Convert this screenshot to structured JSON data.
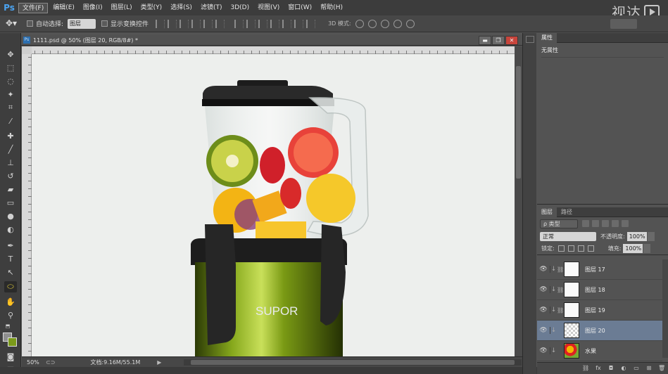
{
  "app": {
    "logo": "Ps",
    "watermark": "视达",
    "menu": [
      "文件(F)",
      "编辑(E)",
      "图像(I)",
      "图层(L)",
      "类型(Y)",
      "选择(S)",
      "滤镜(T)",
      "3D(D)",
      "视图(V)",
      "窗口(W)",
      "帮助(H)"
    ]
  },
  "options_bar": {
    "auto_select_label": "自动选择:",
    "auto_select_value": "图层",
    "show_transform_label": "显示变换控件",
    "mode_3d_label": "3D 模式:"
  },
  "document": {
    "title": "1111.psd @ 50% (图层 20, RGB/8#) *",
    "brand_text": "SUPOR",
    "zoom": "50%",
    "doc_size": "文档:9.16M/55.1M"
  },
  "properties_panel": {
    "tab": "属性",
    "content": "无属性"
  },
  "layers_panel": {
    "tabs": [
      "图层",
      "路径"
    ],
    "kind_filter": "ρ 类型",
    "blend_mode": "正常",
    "opacity_label": "不透明度:",
    "opacity_value": "100%",
    "lock_label": "锁定:",
    "fill_label": "填充:",
    "fill_value": "100%",
    "layers": [
      {
        "name": "图层 17",
        "selected": false
      },
      {
        "name": "图层 18",
        "selected": false
      },
      {
        "name": "图层 19",
        "selected": false
      },
      {
        "name": "图层 20",
        "selected": true
      },
      {
        "name": "水果",
        "selected": false
      }
    ]
  },
  "colors": {
    "selection": "#6b7c94",
    "canvas_bg": "#edefed",
    "blender_green": "#6a8a12"
  }
}
